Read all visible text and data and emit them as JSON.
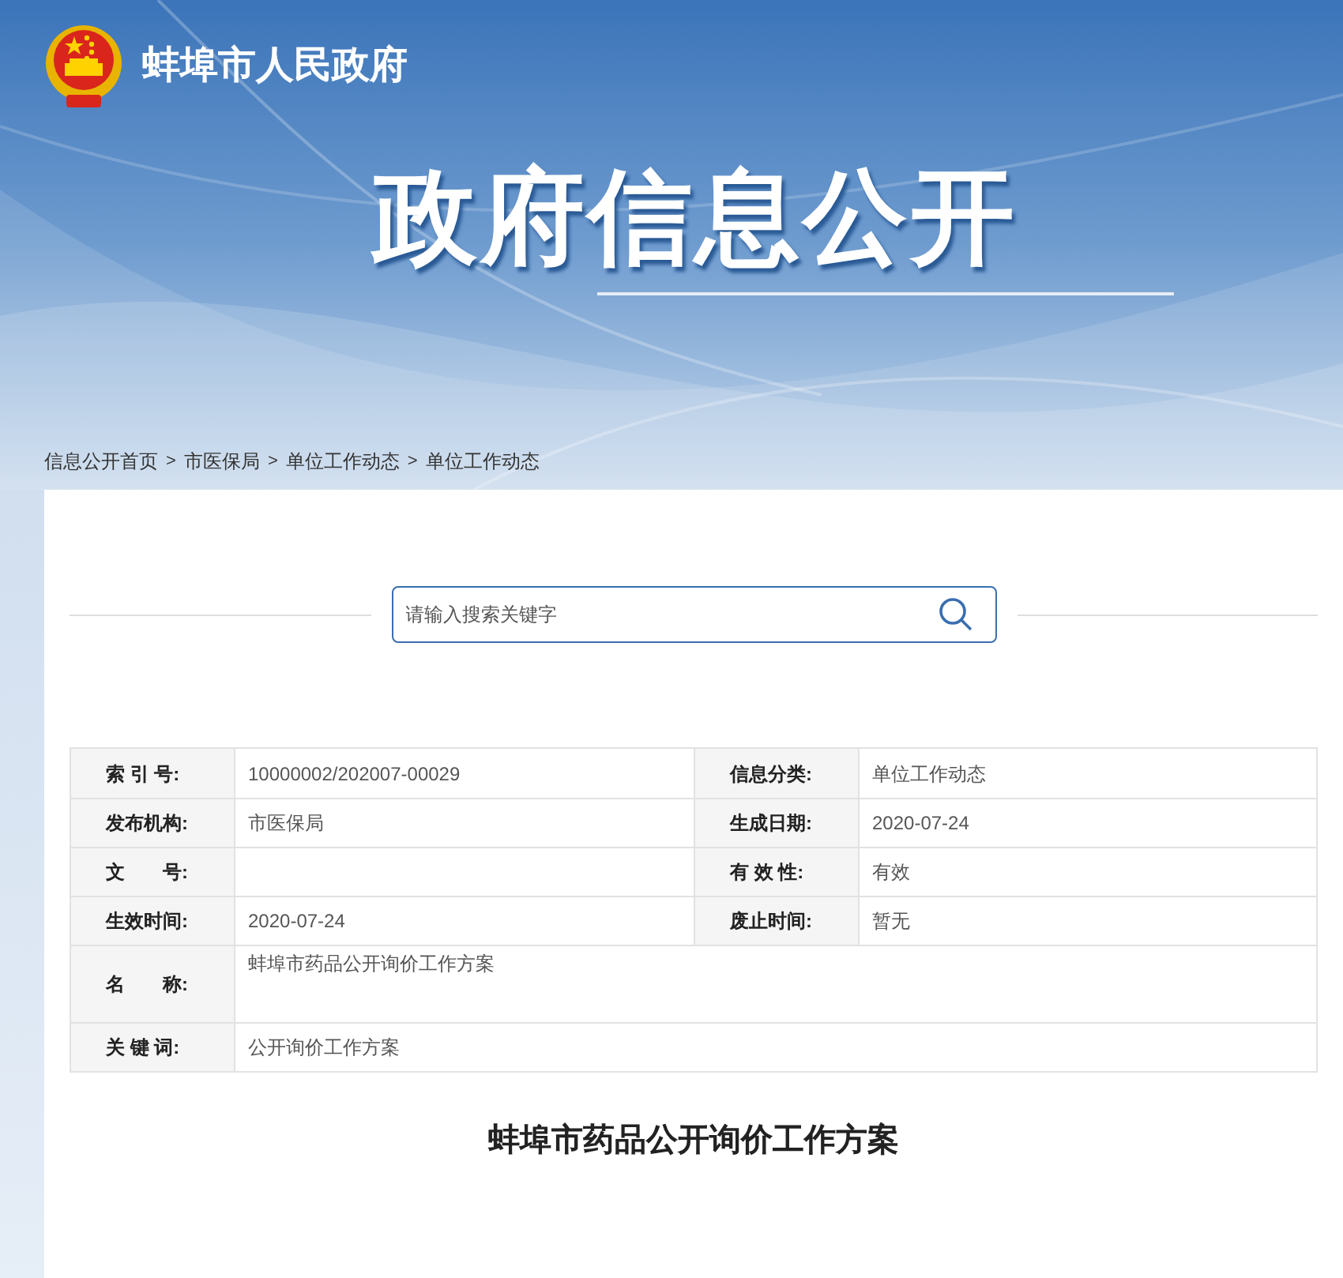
{
  "header": {
    "site_title": "蚌埠市人民政府",
    "banner_title": "政府信息公开"
  },
  "breadcrumb": {
    "separator": ">",
    "items": [
      "信息公开首页",
      "市医保局",
      "单位工作动态",
      "单位工作动态"
    ]
  },
  "search": {
    "placeholder": "请输入搜索关键字"
  },
  "info_table": {
    "rows": [
      {
        "cells": [
          {
            "label": "索 引 号:",
            "value": "10000002/202007-00029"
          },
          {
            "label": "信息分类:",
            "value": "单位工作动态"
          }
        ]
      },
      {
        "cells": [
          {
            "label": "发布机构:",
            "value": "市医保局"
          },
          {
            "label": "生成日期:",
            "value": "2020-07-24"
          }
        ]
      },
      {
        "cells": [
          {
            "label": "文　　号:"
          },
          {
            "label": "有 效 性:",
            "value": "有效"
          }
        ]
      },
      {
        "cells": [
          {
            "label": "生效时间:",
            "value": "2020-07-24"
          },
          {
            "label": "废止时间:",
            "value": "暂无"
          }
        ]
      },
      {
        "kind": "tall",
        "cells": [
          {
            "label": "名　　称:",
            "value": "蚌埠市药品公开询价工作方案"
          }
        ]
      },
      {
        "kind": "wide",
        "cells": [
          {
            "label": "关 键 词:",
            "value": "公开询价工作方案"
          }
        ]
      }
    ]
  },
  "article": {
    "title": "蚌埠市药品公开询价工作方案"
  }
}
